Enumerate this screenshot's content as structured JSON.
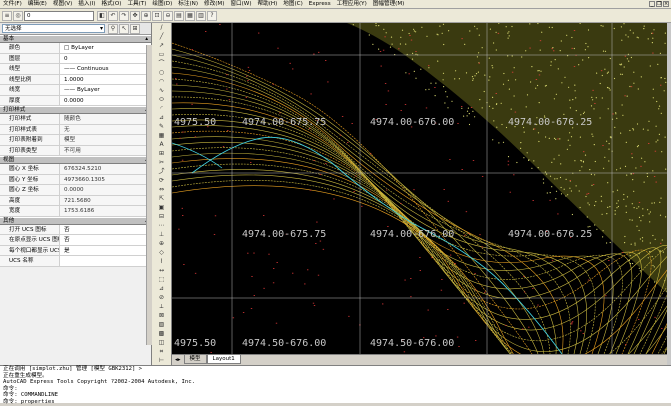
{
  "menubar": {
    "items": [
      "文件(F)",
      "编辑(E)",
      "视图(V)",
      "插入(I)",
      "格式(O)",
      "工具(T)",
      "绘图(D)",
      "标注(N)",
      "修改(M)",
      "窗口(W)",
      "帮助(H)",
      "地图(C)",
      "Express",
      "工程应用(Y)",
      "图幅管理(M)"
    ]
  },
  "toolbar": {
    "layer_value": "0"
  },
  "properties": {
    "selector": "无选择",
    "sections": {
      "general": {
        "title": "基本",
        "rows": [
          {
            "k": "颜色",
            "v": "□ ByLayer"
          },
          {
            "k": "图层",
            "v": "0"
          },
          {
            "k": "线型",
            "v": "—— Continuous"
          },
          {
            "k": "线型比例",
            "v": "1.0000"
          },
          {
            "k": "线宽",
            "v": "—— ByLayer"
          },
          {
            "k": "厚度",
            "v": "0.0000"
          }
        ]
      },
      "plot": {
        "title": "打印样式",
        "rows": [
          {
            "k": "打印样式",
            "v": "随颜色"
          },
          {
            "k": "打印样式表",
            "v": "无"
          },
          {
            "k": "打印表附着到",
            "v": "模型"
          },
          {
            "k": "打印表类型",
            "v": "不可用"
          }
        ]
      },
      "view": {
        "title": "视图",
        "rows": [
          {
            "k": "圆心 X 坐标",
            "v": "676324.5210"
          },
          {
            "k": "圆心 Y 坐标",
            "v": "4973660.1305"
          },
          {
            "k": "圆心 Z 坐标",
            "v": "0.0000"
          },
          {
            "k": "高度",
            "v": "721.5680"
          },
          {
            "k": "宽度",
            "v": "1753.6186"
          }
        ]
      },
      "misc": {
        "title": "其他",
        "rows": [
          {
            "k": "打开 UCS 图标",
            "v": "否"
          },
          {
            "k": "在原点显示 UCS 图标",
            "v": "否"
          },
          {
            "k": "每个视口都显示 UCS",
            "v": "是"
          },
          {
            "k": "UCS 名称",
            "v": ""
          }
        ]
      }
    }
  },
  "drawing": {
    "grid_labels": [
      "4975.50",
      "4974.00-675.75",
      "4974.00-676.00",
      "4974.00-676.25",
      "4974.00-675.75",
      "4974.00-676.00",
      "4974.00-676.25",
      "4975.50",
      "4974.50-676.00",
      "4974.50-676.00"
    ],
    "tabs": [
      "模型",
      "Layout1"
    ]
  },
  "command": {
    "lines": [
      "正在调用 [simplot.zhu] 管理 [模型 GBK2312] >",
      "正在重生成模型。",
      "AutoCAD Express Tools Copyright ?2002-2004 Autodesk, Inc.",
      "命令:",
      "命令: COMMANDLINE",
      "命令: properties"
    ]
  }
}
